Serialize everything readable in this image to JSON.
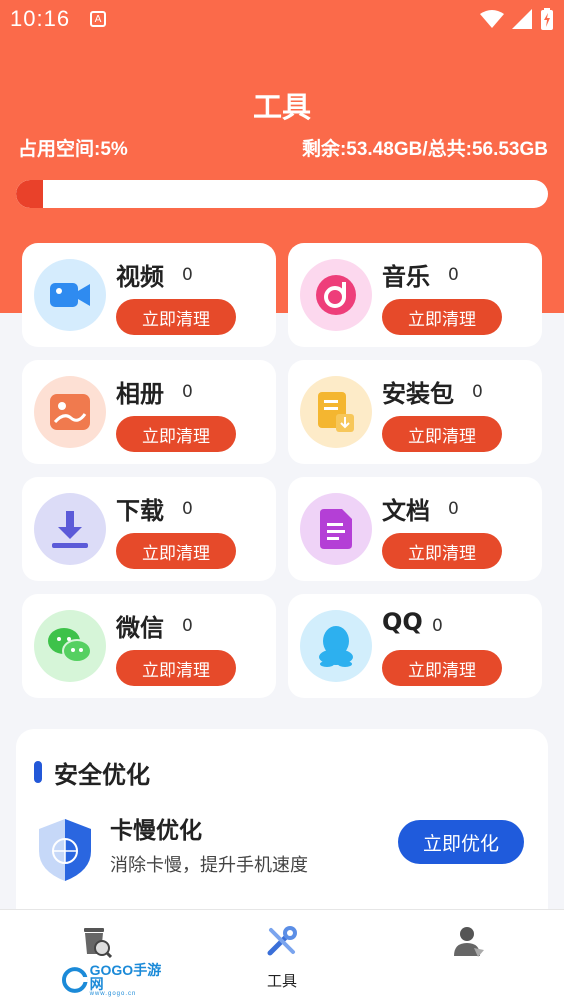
{
  "status": {
    "time": "10:16",
    "notify_icon": "A"
  },
  "header": {
    "title": "工具",
    "used_label": "占用空间:5%",
    "remain_label": "剩余:53.48GB/总共:56.53GB",
    "used_percent": 5
  },
  "categories": [
    {
      "name": "视频",
      "count": "0",
      "button": "立即清理",
      "icon": "video-icon",
      "color": "#2f8bf0"
    },
    {
      "name": "音乐",
      "count": "0",
      "button": "立即清理",
      "icon": "music-icon",
      "color": "#ee3e7a"
    },
    {
      "name": "相册",
      "count": "0",
      "button": "立即清理",
      "icon": "photo-album-icon",
      "color": "#f07a4e"
    },
    {
      "name": "安装包",
      "count": "0",
      "button": "立即清理",
      "icon": "package-icon",
      "color": "#f4b630"
    },
    {
      "name": "下载",
      "count": "0",
      "button": "立即清理",
      "icon": "download-icon",
      "color": "#5b5ad8"
    },
    {
      "name": "文档",
      "count": "0",
      "button": "立即清理",
      "icon": "document-icon",
      "color": "#b43fd6"
    },
    {
      "name": "微信",
      "count": "0",
      "button": "立即清理",
      "icon": "wechat-icon",
      "color": "#3ec24a"
    },
    {
      "name": "QQ",
      "count": "0",
      "button": "立即清理",
      "icon": "qq-icon",
      "color": "#2db0ef"
    }
  ],
  "optimize": {
    "section_title": "安全优化",
    "item_title": "卡慢优化",
    "item_desc": "消除卡慢，提升手机速度",
    "button": "立即优化"
  },
  "nav": [
    {
      "label": "",
      "icon": "trash-clean-icon"
    },
    {
      "label": "工具",
      "icon": "tools-icon"
    },
    {
      "label": "",
      "icon": "user-icon"
    }
  ],
  "watermark": {
    "text": "GOGO手游网",
    "sub": "www.gogo.cn"
  },
  "colors": {
    "accent": "#fb6a4a",
    "button": "#e64a2a",
    "blue": "#1f5bdc"
  }
}
